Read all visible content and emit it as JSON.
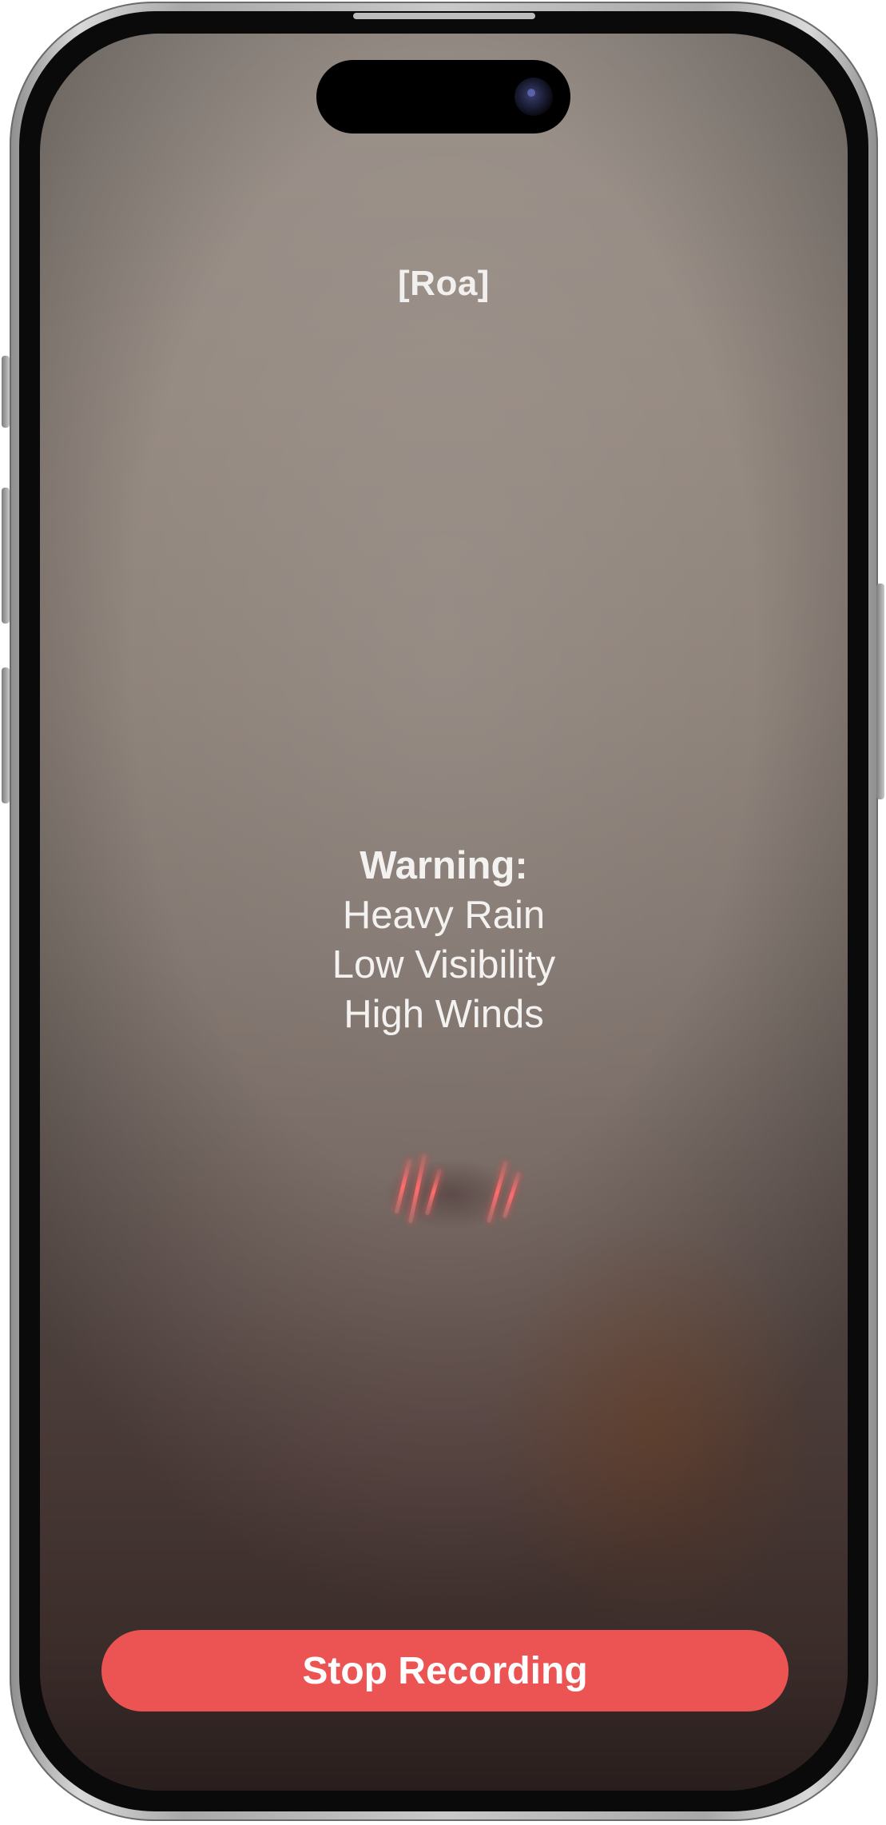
{
  "screen": {
    "title": "[Roa]",
    "warning": {
      "heading": "Warning:",
      "lines": [
        "Heavy Rain",
        "Low Visibility",
        "High Winds"
      ]
    },
    "stop_button_label": "Stop Recording"
  },
  "colors": {
    "button_background": "#ec5454",
    "text": "#f4f2f0",
    "taillight": "#ff6d6d"
  },
  "icons": {
    "camera": "front-camera-icon"
  }
}
